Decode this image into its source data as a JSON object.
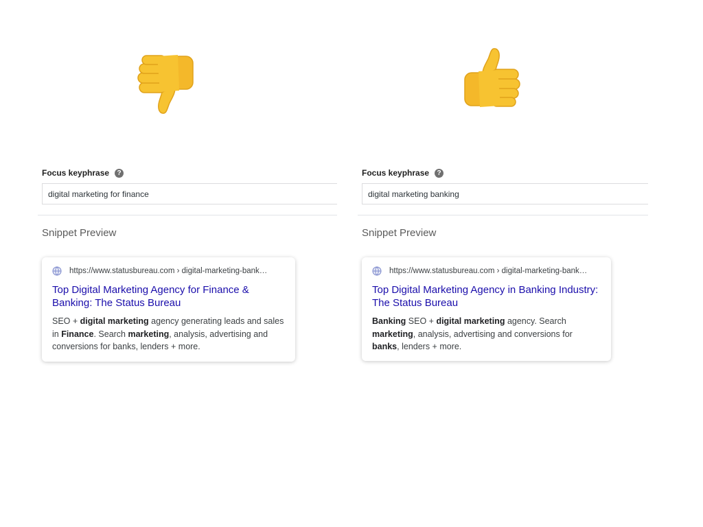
{
  "left": {
    "emoji_icon": "thumbs-down-icon",
    "focus_label": "Focus keyphrase",
    "help_glyph": "?",
    "focus_value": "digital marketing for finance",
    "snippet_heading": "Snippet Preview",
    "serp": {
      "url": "https://www.statusbureau.com › digital-marketing-bank…",
      "title": "Top Digital Marketing Agency for Finance & Banking: The Status Bureau",
      "description": [
        {
          "text": "SEO + ",
          "bold": false
        },
        {
          "text": "digital marketing",
          "bold": true
        },
        {
          "text": " agency generating leads and sales in ",
          "bold": false
        },
        {
          "text": "Finance",
          "bold": true
        },
        {
          "text": ". Search ",
          "bold": false
        },
        {
          "text": "marketing",
          "bold": true
        },
        {
          "text": ", analysis, advertising and conversions for banks, lenders + more.",
          "bold": false
        }
      ]
    }
  },
  "right": {
    "emoji_icon": "thumbs-up-icon",
    "focus_label": "Focus keyphrase",
    "help_glyph": "?",
    "focus_value": "digital marketing banking",
    "snippet_heading": "Snippet Preview",
    "serp": {
      "url": "https://www.statusbureau.com › digital-marketing-bank…",
      "title": "Top Digital Marketing Agency in Banking Industry: The Status Bureau",
      "description": [
        {
          "text": "Banking",
          "bold": true
        },
        {
          "text": " SEO + ",
          "bold": false
        },
        {
          "text": "digital marketing",
          "bold": true
        },
        {
          "text": " agency. Search ",
          "bold": false
        },
        {
          "text": "marketing",
          "bold": true
        },
        {
          "text": ", analysis, advertising and conversions for ",
          "bold": false
        },
        {
          "text": "banks",
          "bold": true
        },
        {
          "text": ", lenders + more.",
          "bold": false
        }
      ]
    }
  },
  "colors": {
    "emoji_yellow": "#F7C331",
    "link_blue": "#1a0dab",
    "text_gray": "#3c4043"
  }
}
